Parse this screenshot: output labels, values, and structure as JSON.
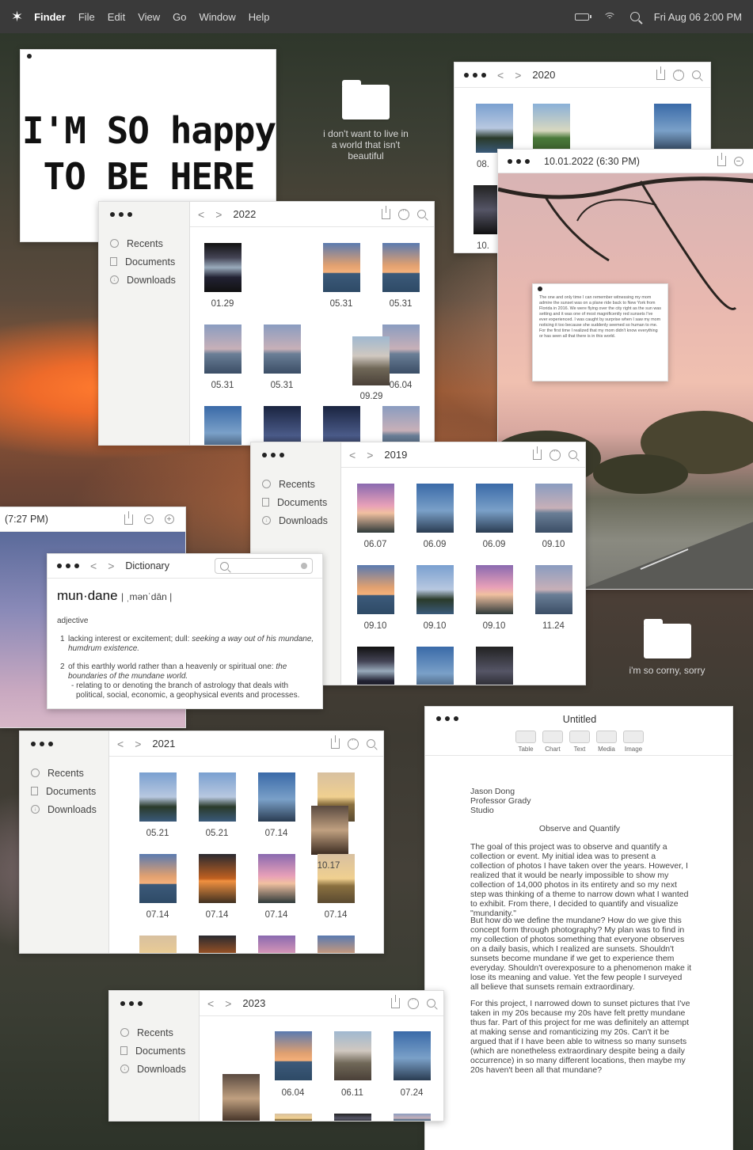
{
  "menubar": {
    "logo": "✶",
    "app": "Finder",
    "menus": [
      "File",
      "Edit",
      "View",
      "Go",
      "Window",
      "Help"
    ],
    "clock": "Fri Aug 06 2:00 PM"
  },
  "desktop": {
    "folder1_label": "i don't want to live in a world that isn't beautiful",
    "folder2_label": "i'm so corny, sorry"
  },
  "happy": {
    "line1": "I'M SO happy",
    "line2": "TO BE HERE"
  },
  "sidebar": {
    "recents": "Recents",
    "documents": "Documents",
    "downloads": "Downloads"
  },
  "nav": {
    "back": "<",
    "forward": ">"
  },
  "win2022": {
    "title": "2022",
    "captions": [
      "01.29",
      "05.31",
      "05.31",
      "05.31",
      "05.31",
      "06.04",
      "09.29"
    ]
  },
  "win2020": {
    "title": "2020",
    "captions": [
      "08.",
      "10."
    ]
  },
  "photo_viewer": {
    "title": "10.01.2022 (6:30 PM)",
    "note": "The one and only time I can remember witnessing my mom admire the sunset was on a plane ride back to New York from Florida in 2016. We were flying over the city right as the sun was setting and it was one of most magnificently red sunsets I've ever experienced. I was caught by surprise when I saw my mom noticing it too because she suddenly seemed so human to me. For the first time I realized that my mom didn't know everything or has seen all that there is in this world."
  },
  "win2019": {
    "title": "2019",
    "captions": [
      "06.07",
      "06.09",
      "06.09",
      "09.10",
      "09.10",
      "09.10",
      "09.10",
      "11.24"
    ]
  },
  "viewer2": {
    "title": "(7:27 PM)"
  },
  "dictionary": {
    "title": "Dictionary",
    "word": "mun·dane",
    "pron": "| ˌmənˈdān |",
    "pos": "adjective",
    "def1_num": "1",
    "def1": "lacking interest or excitement; dull:",
    "def1_ex": "seeking a way out of his mundane, humdrum existence.",
    "def2_num": "2",
    "def2": "of this earthly world rather than a heavenly or spiritual one:",
    "def2_ex": "the boundaries of the mundane world.",
    "def2_sub": "- relating to or denoting the branch of astrology that deals with political, social, economic, a geophysical events and processes."
  },
  "win2021": {
    "title": "2021",
    "captions": [
      "05.21",
      "05.21",
      "07.14",
      "07.14",
      "07.14",
      "07.14",
      "07.14",
      "10.17"
    ]
  },
  "win2023": {
    "title": "2023",
    "captions": [
      "06.04",
      "06.11",
      "07.24"
    ]
  },
  "document": {
    "title": "Untitled",
    "tools": [
      "Table",
      "Chart",
      "Text",
      "Media",
      "Image"
    ],
    "heading_name": "Jason Dong",
    "heading_prof": "Professor Grady",
    "heading_course": "Studio",
    "doc_title": "Observe and Quantify",
    "p1": "The goal of this project was to observe and quantify a collection or event. My initial idea was to present a collection of photos I have taken over the years. However, I realized that it would be nearly impossible to show my collection of 14,000 photos in its entirety and so my next step was thinking of a theme to narrow down what I wanted to exhibit. From there, I decided to quantify and visualize \"mundanity.\"",
    "p2": "But how do we define the mundane? How do we give this concept form through photography? My plan was to find in my collection of photos something that everyone observes on a daily basis, which I realized are sunsets. Shouldn't sunsets become mundane if we get to experience them everyday. Shouldn't overexposure to a phenomenon make it lose its meaning and value. Yet the few people I surveyed all believe that sunsets remain extraordinary.",
    "p3": "For this project, I narrowed down to sunset pictures that I've taken in my 20s because my 20s have felt pretty mundane thus far. Part of this project for me was definitely an attempt at making sense and romanticizing my 20s. Can't it be argued that if I have been able to witness so many sunsets (which are nonetheless extraordinary despite being a daily occurrence) in so many different locations, then maybe my 20s haven't been all that mundane?"
  }
}
